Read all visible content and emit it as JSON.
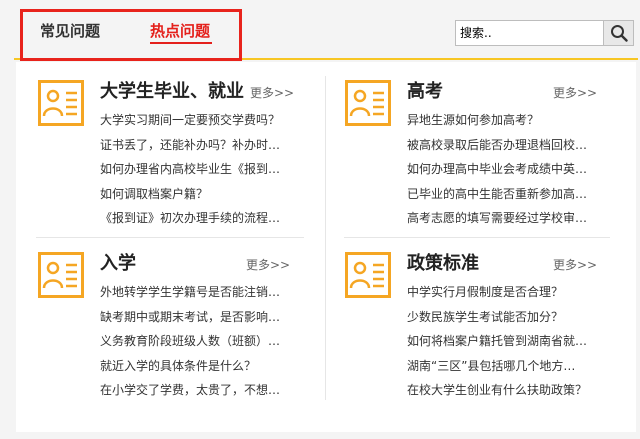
{
  "tabs": {
    "common": "常见问题",
    "hot": "热点问题"
  },
  "search": {
    "placeholder": "搜索..",
    "button_icon": "search-icon"
  },
  "accent_color": "#f7c623",
  "highlight_color": "#e8231c",
  "active_tab_color": "#e4201b",
  "blocks": [
    {
      "icon": "person-card-icon",
      "title": "大学生毕业、就业",
      "more": "更多>>",
      "items": [
        "大学实习期间一定要预交学费吗？",
        "证书丢了，还能补办吗？补办时…",
        "如何办理省内高校毕业生《报到…",
        "如何调取档案户籍？",
        "《报到证》初次办理手续的流程…"
      ]
    },
    {
      "icon": "person-card-icon",
      "title": "高考",
      "more": "更多>>",
      "items": [
        "异地生源如何参加高考？",
        "被高校录取后能否办理退档回校…",
        "如何办理高中毕业会考成绩中英…",
        "已毕业的高中生能否重新参加高…",
        "高考志愿的填写需要经过学校审…"
      ]
    },
    {
      "icon": "person-card-icon",
      "title": "入学",
      "more": "更多>>",
      "items": [
        "外地转学学生学籍号是否能注销…",
        "缺考期中或期末考试，是否影响…",
        "义务教育阶段班级人数（班额）…",
        "就近入学的具体条件是什么？",
        "在小学交了学费，太贵了，不想…"
      ]
    },
    {
      "icon": "person-card-icon",
      "title": "政策标准",
      "more": "更多>>",
      "items": [
        "中学实行月假制度是否合理？",
        "少数民族学生考试能否加分？",
        "如何将档案户籍托管到湖南省就…",
        "湖南“三区”县包括哪几个地方…",
        "在校大学生创业有什么扶助政策？"
      ]
    }
  ]
}
